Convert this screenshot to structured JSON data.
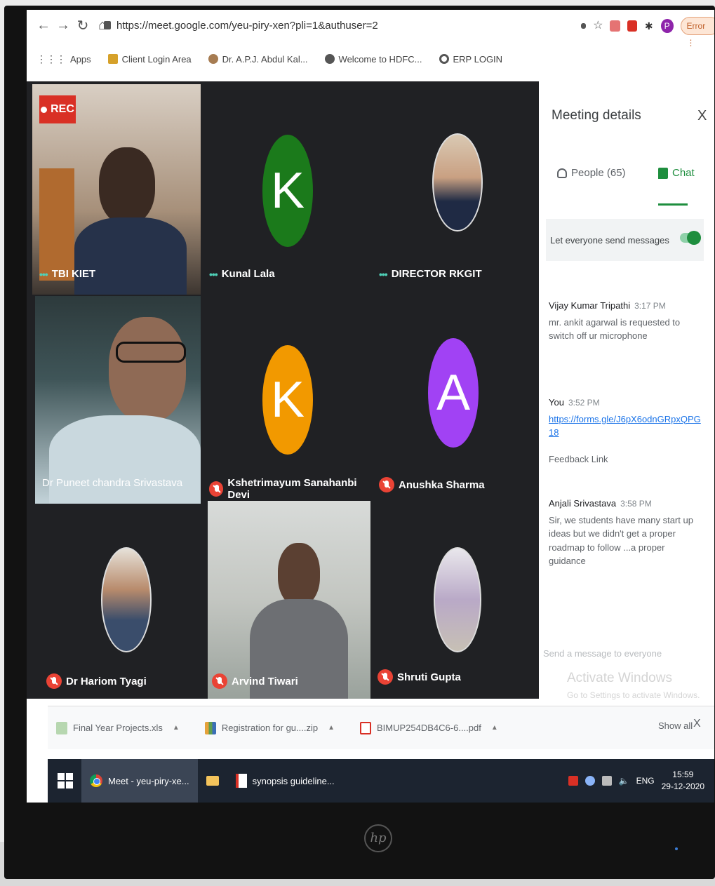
{
  "browser": {
    "url": "https://meet.google.com/yeu-piry-xen?pli=1&authuser=2",
    "profile_initial": "P",
    "error_label": "Error"
  },
  "bookmarks": [
    {
      "label": "Apps"
    },
    {
      "label": "Client Login Area"
    },
    {
      "label": "Dr. A.P.J. Abdul Kal..."
    },
    {
      "label": "Welcome to HDFC..."
    },
    {
      "label": "ERP LOGIN"
    }
  ],
  "meeting": {
    "rec_label": "REC",
    "participants": [
      {
        "name": "TBI KIET"
      },
      {
        "name": "Kunal Lala",
        "initial": "K"
      },
      {
        "name": "DIRECTOR RKGIT"
      },
      {
        "name": "Dr Puneet chandra Srivastava"
      },
      {
        "name": "Kshetrimayum Sanahanbi Devi",
        "initial": "K"
      },
      {
        "name": "Anushka Sharma",
        "initial": "A"
      },
      {
        "name": "Dr Hariom Tyagi"
      },
      {
        "name": "Arvind Tiwari"
      },
      {
        "name": "Shruti Gupta"
      }
    ]
  },
  "panel": {
    "title": "Meeting details",
    "close": "X",
    "tab_people": "People (65)",
    "tab_chat": "Chat",
    "setting_label": "Let everyone send messages",
    "messages": [
      {
        "sender": "Vijay Kumar Tripathi",
        "time": "3:17 PM",
        "text": "mr. ankit agarwal is requested to switch off ur microphone"
      },
      {
        "sender": "You",
        "time": "3:52 PM",
        "link": "https://forms.gle/J6pX6odnGRpxQPG18",
        "text": "Feedback Link"
      },
      {
        "sender": "Anjali Srivastava",
        "time": "3:58 PM",
        "text": "Sir, we students have many start up ideas but we didn't get a proper roadmap to follow ...a proper guidance"
      }
    ],
    "input_placeholder": "Send a message to everyone",
    "watermark_title": "Activate Windows",
    "watermark_sub": "Go to Settings to activate Windows."
  },
  "downloads": {
    "items": [
      {
        "label": "Final Year Projects.xls"
      },
      {
        "label": "Registration for gu....zip"
      },
      {
        "label": "BIMUP254DB4C6-6....pdf"
      }
    ],
    "show_all": "Show all",
    "close": "X"
  },
  "taskbar": {
    "apps": [
      {
        "label": "Meet - yeu-piry-xe..."
      },
      {
        "label": "synopsis guideline..."
      }
    ],
    "lang": "ENG",
    "time": "15:59",
    "date": "29-12-2020"
  }
}
